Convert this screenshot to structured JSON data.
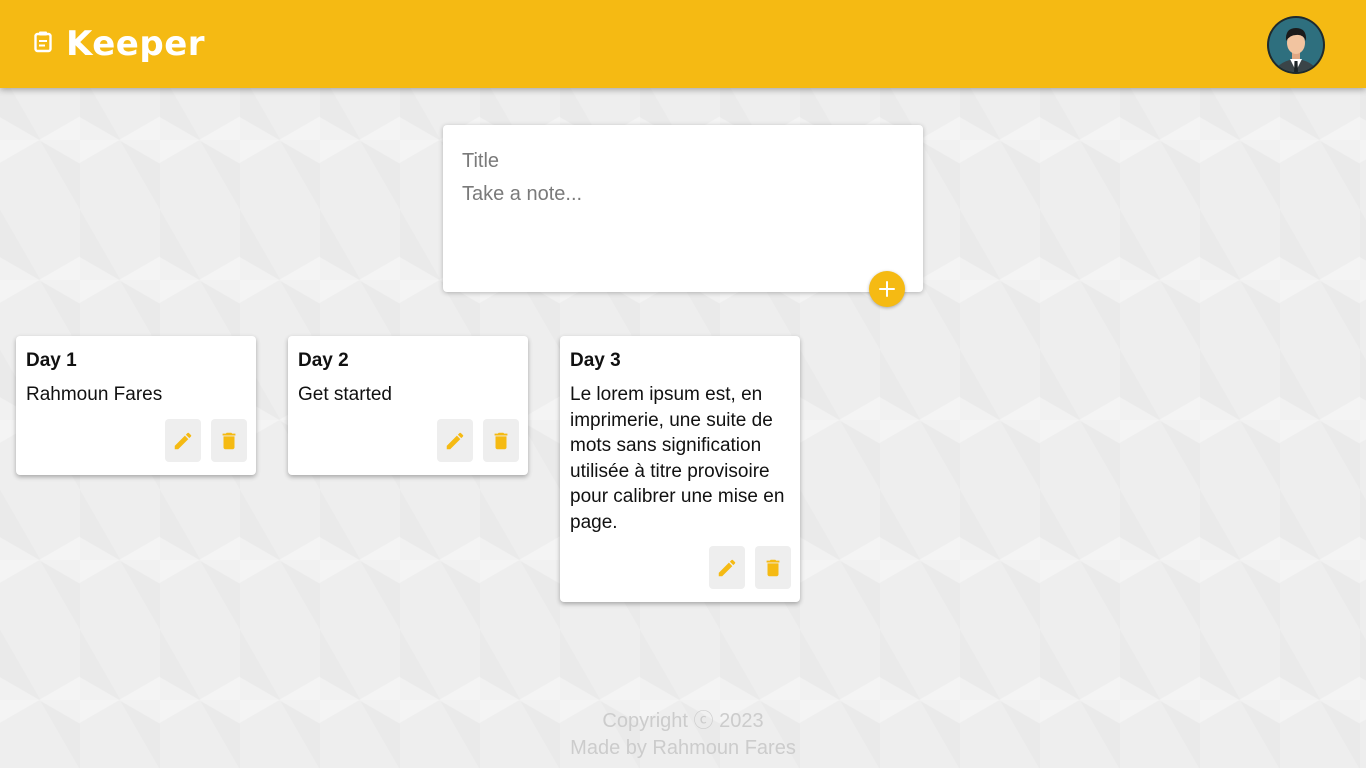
{
  "header": {
    "title": "Keeper",
    "brand_icon": "note-icon",
    "avatar_icon": "user-avatar",
    "accent_color": "#f5ba13"
  },
  "composer": {
    "title_placeholder": "Title",
    "content_placeholder": "Take a note...",
    "add_icon": "plus-icon"
  },
  "notes": [
    {
      "title": "Day 1",
      "content": "Rahmoun Fares"
    },
    {
      "title": "Day 2",
      "content": "Get started"
    },
    {
      "title": "Day 3",
      "content": "Le lorem ipsum est, en imprimerie, une suite de mots sans signification utilisée à titre provisoire pour calibrer une mise en page."
    }
  ],
  "note_actions": {
    "edit_icon": "pencil-icon",
    "delete_icon": "trash-icon"
  },
  "footer": {
    "copyright": "Copyright ⓒ 2023",
    "credit": "Made by Rahmoun Fares"
  }
}
